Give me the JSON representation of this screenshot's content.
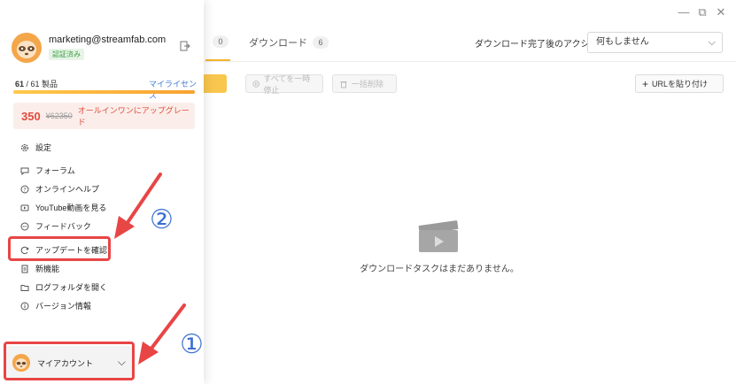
{
  "window": {
    "controls": [
      "—",
      "⧉",
      "✕"
    ]
  },
  "tabs": [
    {
      "count": "0"
    },
    {
      "label": "ダウンロード",
      "count": "6"
    }
  ],
  "after_download": {
    "label": "ダウンロード完了後のアクション：",
    "value": "何もしません"
  },
  "toolbar": {
    "pause_all": "すべてを一時停止",
    "delete_all": "一括削除",
    "paste_url": "URLを貼り付け"
  },
  "empty_state": {
    "message": "ダウンロードタスクはまだありません。"
  },
  "account": {
    "email": "marketing@streamfab.com",
    "verified": "認証済み",
    "products_count": "61",
    "products_total": "/ 61 製品",
    "products_fraction": 1.0,
    "license_link": "マイライセンス",
    "promo": {
      "price": "350",
      "old_price": "¥62350",
      "text": "オールインワンにアップグレード"
    },
    "menu": {
      "settings": "設定",
      "forum": "フォーラム",
      "online_help": "オンラインヘルプ",
      "youtube": "YouTube動画を見る",
      "feedback": "フィードバック",
      "check_update": "アップデートを確認",
      "new_features": "新機能",
      "open_log": "ログフォルダを開く",
      "version": "バージョン情報"
    },
    "my_account": "マイアカウント"
  },
  "annotations": {
    "one": "①",
    "two": "②"
  },
  "colors": {
    "accent": "#f4b42c",
    "promo": "#e24b3b",
    "link": "#3a7bd5",
    "highlight": "#e84545",
    "annotation_number": "#3b6fd4"
  }
}
